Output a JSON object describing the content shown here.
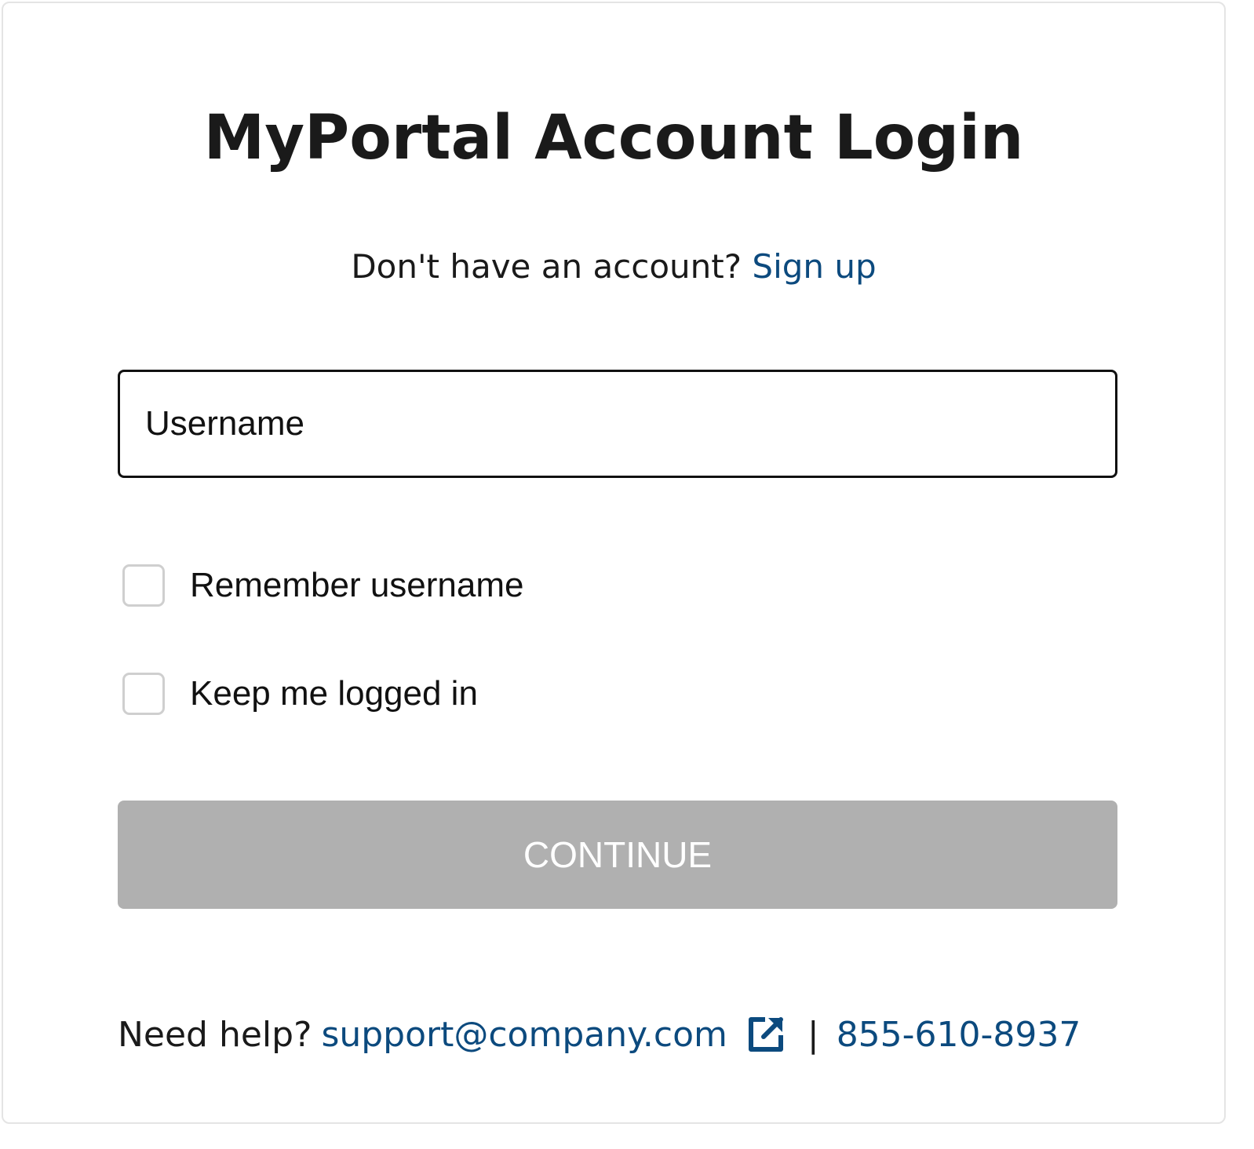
{
  "login": {
    "title": "MyPortal Account Login",
    "signup_prompt": "Don't have an account?",
    "signup_link": "Sign up",
    "username_placeholder": "Username",
    "username_value": "",
    "remember_username_label": "Remember username",
    "remember_username_checked": false,
    "keep_logged_in_label": "Keep me logged in",
    "keep_logged_in_checked": false,
    "continue_label": "CONTINUE",
    "continue_enabled": false
  },
  "help": {
    "prompt": "Need help?",
    "email": "support@company.com",
    "external_icon": "external-link-icon",
    "separator": "|",
    "phone": "855-610-8937"
  },
  "colors": {
    "link": "#0c4a7e",
    "text": "#1a1a1a",
    "button_disabled_bg": "#b0b0b0",
    "button_text": "#ffffff",
    "checkbox_border": "#cfcfcf",
    "card_border": "#e4e4e4"
  }
}
